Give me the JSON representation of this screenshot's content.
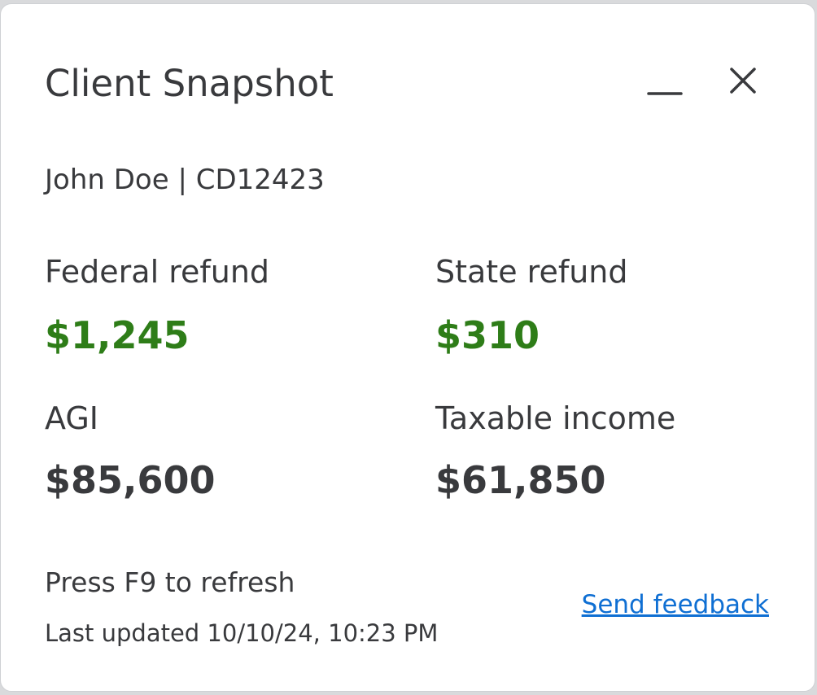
{
  "panel": {
    "title": "Client Snapshot",
    "client_line": "John Doe | CD12423"
  },
  "window_controls": {
    "minimize_icon": "minimize-icon",
    "close_icon": "close-icon"
  },
  "metrics": {
    "federal_refund": {
      "label": "Federal refund",
      "value": "$1,245"
    },
    "state_refund": {
      "label": "State refund",
      "value": "$310"
    },
    "agi": {
      "label": "AGI",
      "value": "$85,600"
    },
    "taxable_income": {
      "label": "Taxable income",
      "value": "$61,850"
    }
  },
  "footer": {
    "refresh_hint": "Press F9 to refresh",
    "last_updated": "Last updated 10/10/24, 10:23 PM",
    "feedback_link": "Send feedback"
  },
  "colors": {
    "refund_green": "#2e7d18",
    "text_dark": "#393a3d",
    "link_blue": "#0f6fd3"
  }
}
